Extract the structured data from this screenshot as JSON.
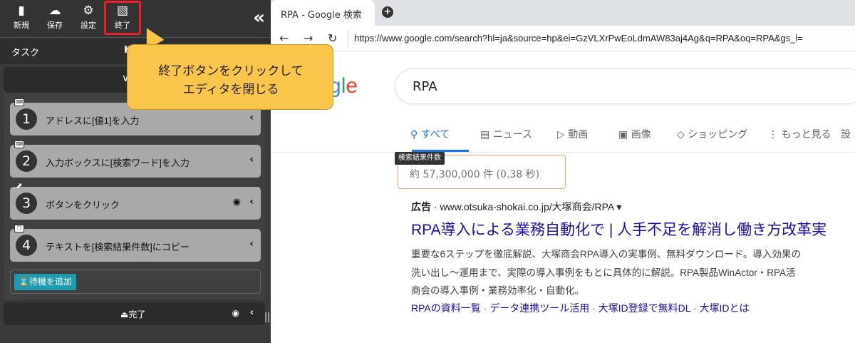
{
  "toolbar": {
    "new_label": "新規",
    "save_label": "保存",
    "settings_label": "設定",
    "exit_label": "終了",
    "collapse_glyph": "«"
  },
  "tabs": {
    "task": "タスク",
    "k": "K"
  },
  "callout": {
    "line1": "終了ボタンをクリックして",
    "line2": "エディタを閉じる"
  },
  "steps": [
    {
      "num": "1",
      "label": "アドレスに[値1]を入力",
      "icon": "keyboard-icon",
      "camera": false
    },
    {
      "num": "2",
      "label": "入力ボックスに[検索ワード]を入力",
      "icon": "keyboard-icon",
      "camera": false
    },
    {
      "num": "3",
      "label": "ボタンをクリック",
      "icon": "cursor-icon",
      "camera": true
    },
    {
      "num": "4",
      "label": "テキストを[検索結果件数]にコピー",
      "icon": "copy-icon",
      "camera": false
    }
  ],
  "wait_button": "待機を追加",
  "done_label": "完了",
  "browser": {
    "tab_title": "RPA - Google 検索",
    "url": "https://www.google.com/search?hl=ja&source=hp&ei=GzVLXrPwEoLdmAW83aj4Ag&q=RPA&oq=RPA&gs_l=",
    "logo_g": "g",
    "logo_l": "l",
    "logo_e": "e",
    "query": "RPA",
    "tabs": [
      "すべて",
      "ニュース",
      "動画",
      "画像",
      "ショッピング",
      "もっと見る",
      "設"
    ],
    "tooltip": "検索結果件数",
    "stats": "約 57,300,000 件 (0.38 秒)",
    "ad_label": "広告",
    "ad_url": " · www.otsuka-shokai.co.jp/大塚商会/RPA ▾",
    "ad_title": "RPA導入による業務自動化で | 人手不足を解消し働き方改革実",
    "ad_desc": [
      "重要な6ステップを徹底解説、大塚商会RPA導入の実事例、無料ダウンロード。導入効果の",
      "洗い出し～運用まで、実際の導入事例をもとに具体的に解説。RPA製品WinActor・RPA活",
      "商会の導入事例・業務効率化・自動化。"
    ],
    "ad_links": [
      "RPAの資料一覧",
      "データ連携ツール活用",
      "大塚ID登録で無料DL",
      "大塚IDとは"
    ]
  },
  "colors": {
    "accent_blue": "#1a73e8",
    "link_blue": "#1a0dab",
    "callout_yellow": "#f9c54b",
    "highlight_red": "#e8202a",
    "wait_button_teal": "#1f9bb0"
  }
}
